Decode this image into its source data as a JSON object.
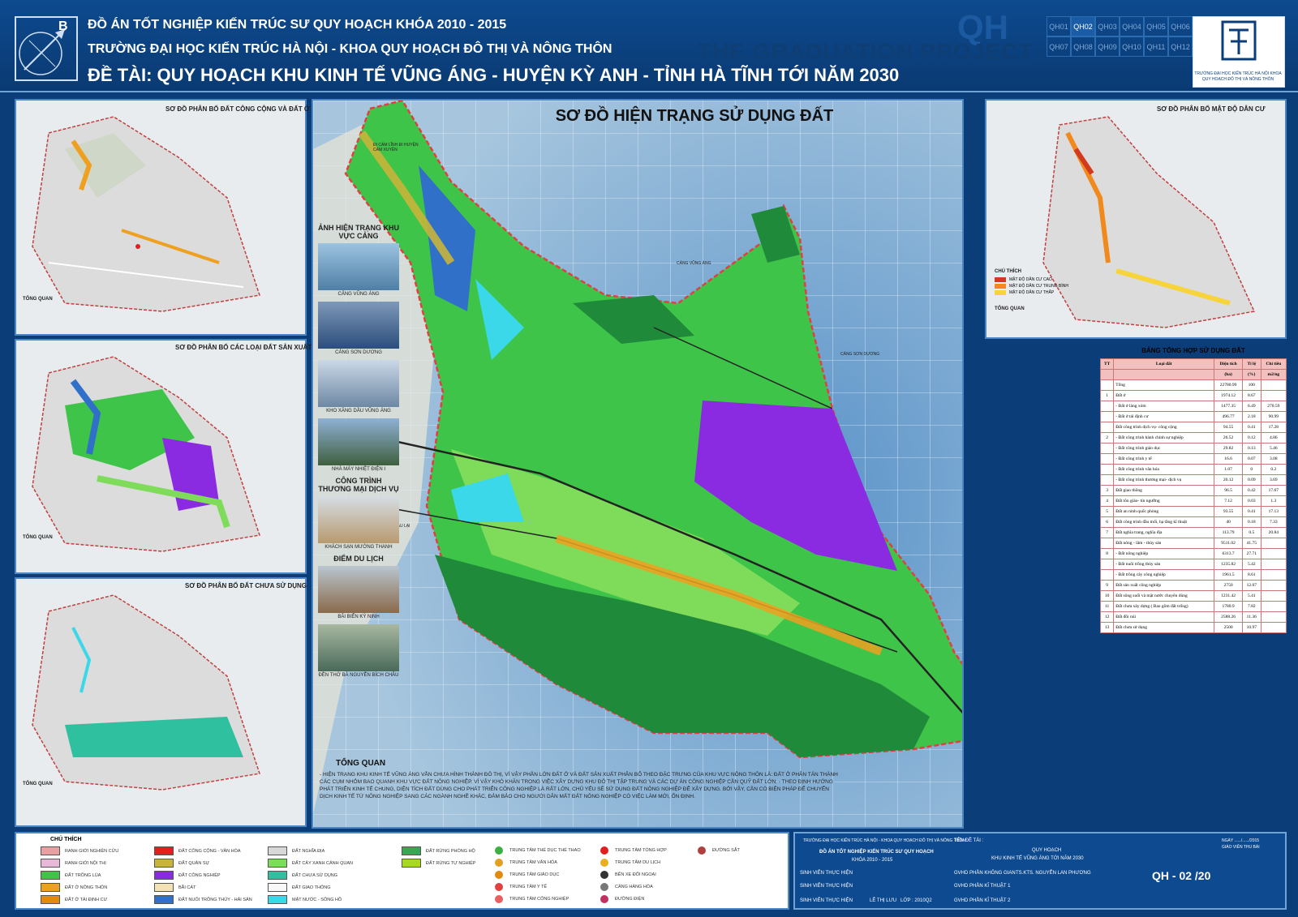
{
  "header": {
    "line1": "ĐỒ ÁN TỐT NGHIỆP KIẾN TRÚC SƯ QUY HOẠCH KHÓA 2010 - 2015",
    "line2": "TRƯỜNG ĐẠI HỌC KIẾN TRÚC HÀ NỘI - KHOA QUY HOẠCH ĐÔ THỊ VÀ NÔNG THÔN",
    "line3": "ĐỀ TÀI: QUY HOẠCH KHU KINH TẾ VŨNG ÁNG - HUYỆN KỲ ANH - TỈNH HÀ TĨNH TỚI NĂM 2030",
    "compass_letter": "B",
    "qh_logo": "QH",
    "graduation": "THE GRADUATION PROJECT",
    "sheets": [
      "QH01",
      "QH02",
      "QH03",
      "QH04",
      "QH05",
      "QH06",
      "QH07",
      "QH08",
      "QH09",
      "QH10",
      "QH11",
      "QH12"
    ],
    "active_sheet": "QH02",
    "school_name": "TRƯỜNG ĐẠI HỌC KIẾN TRÚC HÀ NỘI KHOA QUY HOẠCH ĐÔ THỊ VÀ NÔNG THÔN"
  },
  "left_panels": [
    {
      "title": "SƠ ĐỒ PHÂN BỐ ĐẤT CÔNG CỘNG VÀ ĐẤT Ở",
      "note_title": "TỔNG QUAN"
    },
    {
      "title": "SƠ ĐỒ PHÂN BỐ CÁC LOẠI ĐẤT SẢN XUẤT",
      "note_title": "TỔNG QUAN"
    },
    {
      "title": "SƠ ĐỒ PHÂN BỐ ĐẤT CHƯA SỬ DỤNG",
      "note_title": "TỔNG QUAN"
    }
  ],
  "main_map": {
    "title": "SƠ ĐỒ HIỆN TRẠNG SỬ DỤNG ĐẤT",
    "labels": [
      "ĐI CẨM LĨNH ĐI HUYỆN CẨM XUYÊN",
      "CẢNG VŨNG ÁNG",
      "CẢNG SƠN DƯƠNG",
      "ĐI CHÂU LẠI"
    ],
    "photos_title": "ẢNH HIỆN TRẠNG KHU VỰC CẢNG",
    "photos": [
      "CẢNG VŨNG ÁNG",
      "CẢNG SƠN DƯƠNG",
      "KHO XĂNG DẦU VŨNG ÁNG",
      "NHÀ MÁY NHIỆT ĐIỆN I"
    ],
    "commerce_title": "CÔNG TRÌNH THƯƠNG MẠI DỊCH VỤ",
    "commerce_photos": [
      "KHÁCH SẠN MƯỜNG THANH"
    ],
    "tourism_title": "ĐIỂM DU LỊCH",
    "tourism_photos": [
      "BÃI BIỂN KỲ NINH",
      "ĐỀN THỜ BÀ NGUYỄN BÍCH CHÂU"
    ],
    "overview_title": "TỔNG QUAN",
    "overview": "- HIỆN TRẠNG KHU KINH TẾ VŨNG ÁNG VẪN CHƯA HÌNH THÀNH ĐÔ THỊ, VÌ VẬY PHẦN LỚN ĐẤT Ở VÀ ĐẤT SẢN XUẤT PHÂN BỐ THEO ĐẶC TRƯNG CỦA KHU VỰC NÔNG THÔN LÀ: ĐẤT Ở PHÂN TÁN THÀNH CÁC CỤM NHỎM BAO QUANH KHU VỰC ĐẤT NÔNG NGHIỆP. VÌ VẬY KHÓ KHĂN TRONG VIỆC XÂY DỰNG KHU ĐÔ THỊ TẬP TRUNG VÀ CÁC DỰ ÁN CÔNG NGHIỆP CẦN QUỸ ĐẤT LỚN. - THEO ĐỊNH HƯỚNG PHÁT TRIỂN KINH TẾ CHUNG, DIỆN TÍCH ĐẤT DÙNG CHO PHÁT TRIỂN CÔNG NGHIỆP LÀ RẤT LỚN, CHỦ YẾU SẼ SỬ DỤNG ĐẤT NÔNG NGHIỆP ĐỂ XÂY DỰNG. BỞI VẬY, CẦN CÓ BIỆN PHÁP ĐỂ CHUYỂN DỊCH KINH TẾ TỪ NÔNG NGHIỆP SANG CÁC NGÀNH NGHỀ KHÁC, ĐẢM BẢO CHO NGƯỜI DÂN MẤT ĐẤT NÔNG NGHIỆP CÓ VIỆC LÀM MỚI, ỔN ĐỊNH."
  },
  "right_panel": {
    "title": "SƠ ĐỒ PHÂN BỐ MẬT ĐỘ DÂN CƯ",
    "legend_title": "CHÚ THÍCH",
    "legend": [
      {
        "label": "MẬT ĐỘ DÂN CƯ CAO",
        "color": "#d23a1e"
      },
      {
        "label": "MẬT ĐỘ DÂN CƯ TRUNG BÌNH",
        "color": "#f08a1c"
      },
      {
        "label": "MẬT ĐỘ DÂN CƯ THẤP",
        "color": "#f7d43a"
      }
    ],
    "note_title": "TỔNG QUAN"
  },
  "table": {
    "title": "BẢNG TỔNG HỢP SỬ DỤNG ĐẤT",
    "headers": [
      "TT",
      "Loại đất",
      "Diện tích",
      "Tỉ lệ",
      "Chỉ tiêu"
    ],
    "units": [
      "",
      "",
      "(ha)",
      "(%)",
      "m2/ng"
    ],
    "rows": [
      [
        "",
        "Tổng",
        "22780.99",
        "100",
        ""
      ],
      [
        "1",
        "Đất ở",
        "1974.12",
        "8.67",
        ""
      ],
      [
        "",
        "- Đất ở làng xóm",
        "1477.35",
        "6.49",
        "270.59"
      ],
      [
        "",
        "- Đất ở tái định cư",
        "496.77",
        "2.18",
        "90.99"
      ],
      [
        "",
        "Đất công trình dịch vụ- công cộng",
        "94.55",
        "0.41",
        "17.28"
      ],
      [
        "2",
        "- Đất công trình hành chính sự nghiệp",
        "26.52",
        "0.12",
        "4.86"
      ],
      [
        "",
        "- Đất công trình giáo dục",
        "29.82",
        "0.13",
        "5.46"
      ],
      [
        "",
        "- Đất công trình y tế",
        "16.6",
        "0.07",
        "3.08"
      ],
      [
        "",
        "- Đất công trình văn hóa",
        "1.07",
        "0",
        "0.2"
      ],
      [
        "",
        "- Đất công trình thương mại- dịch vụ",
        "20.12",
        "0.09",
        "3.69"
      ],
      [
        "3",
        "Đất giao thông",
        "96.5",
        "0.42",
        "17.67"
      ],
      [
        "4",
        "Đất tôn giáo- tín ngưỡng",
        "7.12",
        "0.03",
        "1.3"
      ],
      [
        "5",
        "Đất an ninh quốc phòng",
        "93.55",
        "0.41",
        "17.13"
      ],
      [
        "6",
        "Đất công trình đầu mối, hạ tầng kĩ thuật",
        "40",
        "0.18",
        "7.33"
      ],
      [
        "7",
        "Đất nghĩa trang, nghĩa địa",
        "113.79",
        "0.5",
        "20.84"
      ],
      [
        "",
        "Đất nông - lâm - thủy sản",
        "9511.02",
        "41.75",
        ""
      ],
      [
        "8",
        "- Đất nông nghiệp",
        "6313.7",
        "27.71",
        ""
      ],
      [
        "",
        "- Đất nuôi trồng thủy sản",
        "1235.82",
        "5.42",
        ""
      ],
      [
        "",
        "- Đất trồng cây công nghiệp",
        "1961.5",
        "8.61",
        ""
      ],
      [
        "9",
        "Đất sản xuất công nghiệp",
        "2750",
        "12.07",
        ""
      ],
      [
        "10",
        "Đất sông suối và mặt nước chuyên dùng",
        "1231.42",
        "5.41",
        ""
      ],
      [
        "11",
        "Đất chưa xây dựng ( Bao gồm đất trống)",
        "1780.9",
        "7.82",
        ""
      ],
      [
        "12",
        "Đất đồi núi",
        "2588.26",
        "11.36",
        ""
      ],
      [
        "13",
        "Đất chưa sử dụng",
        "2500",
        "10.97",
        ""
      ]
    ]
  },
  "legend": {
    "title": "CHÚ THÍCH",
    "items": [
      {
        "label": "RANH GIỚI NGHIÊN CỨU",
        "color": "#e8a0a0"
      },
      {
        "label": "RANH GIỚI NỘI THỊ",
        "color": "#e8b8d8"
      },
      {
        "label": "ĐẤT TRỒNG LÚA",
        "color": "#3fc44a"
      },
      {
        "label": "ĐẤT Ở NÔNG THÔN",
        "color": "#f0a020"
      },
      {
        "label": "ĐẤT Ở TÁI ĐỊNH CƯ",
        "color": "#e08a10"
      },
      {
        "label": "ĐẤT CÔNG CỘNG - VĂN HÓA",
        "color": "#e02020"
      },
      {
        "label": "ĐẤT QUÂN SỰ",
        "color": "#c8b43a"
      },
      {
        "label": "ĐẤT CÔNG NGHIỆP",
        "color": "#8a2be2"
      },
      {
        "label": "BÃI CÁT",
        "color": "#f3e2b4"
      },
      {
        "label": "ĐẤT NUÔI TRỒNG THỦY - HẢI SẢN",
        "color": "#3070c8"
      },
      {
        "label": "ĐẤT NGHĨA ĐỊA",
        "color": "#d8d8d8"
      },
      {
        "label": "ĐẤT CÂY XANH CẢNH QUAN",
        "color": "#7fdc5a"
      },
      {
        "label": "ĐẤT CHƯA SỬ DỤNG",
        "color": "#2fc0a0"
      },
      {
        "label": "ĐẤT GIAO THÔNG",
        "color": "#f8f8f8"
      },
      {
        "label": "MẶT NƯỚC - SÔNG HỒ",
        "color": "#3ad8e8"
      },
      {
        "label": "ĐẤT RỪNG PHÒNG HỘ",
        "color": "#34a853"
      },
      {
        "label": "ĐẤT RỪNG TỰ NGHIỆP",
        "color": "#a8d820"
      }
    ],
    "icons": [
      {
        "label": "TRUNG TÂM THỂ DỤC THỂ THAO",
        "color": "#3cb043"
      },
      {
        "label": "TRUNG TÂM VĂN HÓA",
        "color": "#e0a020"
      },
      {
        "label": "TRUNG TÂM GIÁO DỤC",
        "color": "#e08a10"
      },
      {
        "label": "TRUNG TÂM Y TẾ",
        "color": "#e04040"
      },
      {
        "label": "TRUNG TÂM CÔNG NGHIỆP",
        "color": "#e86060"
      },
      {
        "label": "TRUNG TÂM TỔNG HỢP",
        "color": "#e02020"
      },
      {
        "label": "TRUNG TÂM DU LỊCH",
        "color": "#e8b020"
      },
      {
        "label": "BẾN XE ĐỐI NGOẠI",
        "color": "#333333"
      },
      {
        "label": "CẢNG HÀNG HÓA",
        "color": "#777777"
      },
      {
        "label": "ĐƯỜNG ĐIỆN",
        "color": "#c03060"
      },
      {
        "label": "ĐƯỜNG SẮT",
        "color": "#b04040"
      }
    ]
  },
  "info": {
    "school": "TRƯỜNG ĐẠI HỌC KIẾN TRÚC HÀ NỘI - KHOA QUY HOẠCH ĐÔ THỊ VÀ NÔNG THÔN",
    "project": "ĐỒ ÁN TỐT NGHIỆP KIẾN TRÚC SƯ QUY HOẠCH",
    "course": "KHÓA 2010 - 2015",
    "topic_label": "TÊN ĐỀ TÀI :",
    "topic": "QUY HOẠCH",
    "topic2": "KHU KINH TẾ VŨNG ÁNG TỚI NĂM 2030",
    "student_label": "SINH VIÊN THỰC HIỆN",
    "student": "LÊ THỊ LƯU",
    "class": "LỚP : 2010Q2",
    "advisor_label": "GVHD PHẦN KHÔNG GIAN",
    "advisor": "TS.KTS. NGUYỄN LAN PHƯƠNG",
    "advisor2_label": "GVHD PHẦN KĨ THUẬT 1",
    "advisor3_label": "GVHD PHẦN KĨ THUẬT 2",
    "date": "NGÀY ....../....../2015",
    "reviewer": "GIÁO VIÊN THU BÀI",
    "sheet_code": "QH - 02 /20"
  },
  "colors": {
    "brand": "#0d4a8f",
    "border": "#4d86c4",
    "industrial": "#8a2be2",
    "rice": "#3fc44a"
  }
}
